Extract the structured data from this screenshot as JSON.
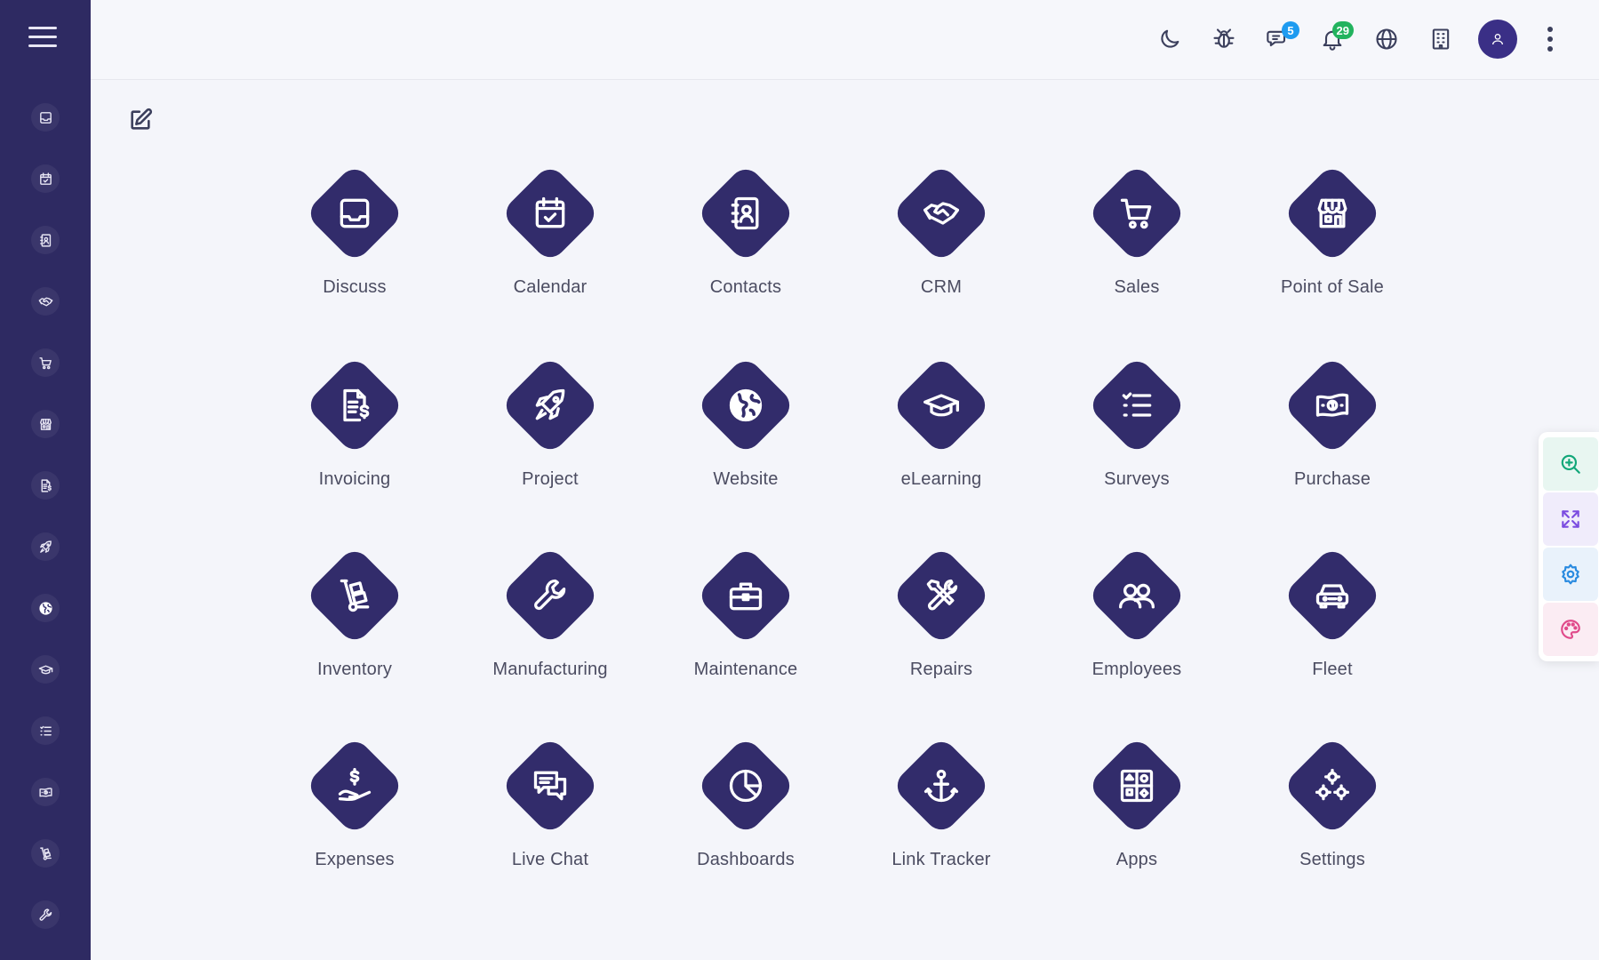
{
  "colors": {
    "sidebar_bg": "#2e2a62",
    "tile_bg": "#322c6b",
    "page_bg": "#f4f5fa",
    "badge_blue": "#1e9bf0",
    "badge_green": "#22b35e"
  },
  "sidebar": {
    "items": [
      {
        "icon": "inbox-icon"
      },
      {
        "icon": "calendar-check-icon"
      },
      {
        "icon": "contact-book-icon"
      },
      {
        "icon": "handshake-icon"
      },
      {
        "icon": "cart-icon"
      },
      {
        "icon": "store-icon"
      },
      {
        "icon": "invoice-icon"
      },
      {
        "icon": "rocket-icon"
      },
      {
        "icon": "globe-icon"
      },
      {
        "icon": "graduation-cap-icon"
      },
      {
        "icon": "checklist-icon"
      },
      {
        "icon": "banknote-icon"
      },
      {
        "icon": "hand-truck-icon"
      },
      {
        "icon": "wrench-icon"
      }
    ]
  },
  "topbar": {
    "chat_badge": "5",
    "notification_badge": "29"
  },
  "apps": [
    {
      "label": "Discuss",
      "icon": "inbox-icon"
    },
    {
      "label": "Calendar",
      "icon": "calendar-check-icon"
    },
    {
      "label": "Contacts",
      "icon": "contact-book-icon"
    },
    {
      "label": "CRM",
      "icon": "handshake-icon"
    },
    {
      "label": "Sales",
      "icon": "cart-icon"
    },
    {
      "label": "Point of Sale",
      "icon": "store-icon"
    },
    {
      "label": "Invoicing",
      "icon": "invoice-icon"
    },
    {
      "label": "Project",
      "icon": "rocket-icon"
    },
    {
      "label": "Website",
      "icon": "globe-icon"
    },
    {
      "label": "eLearning",
      "icon": "graduation-cap-icon"
    },
    {
      "label": "Surveys",
      "icon": "checklist-icon"
    },
    {
      "label": "Purchase",
      "icon": "banknote-icon"
    },
    {
      "label": "Inventory",
      "icon": "hand-truck-icon"
    },
    {
      "label": "Manufacturing",
      "icon": "wrench-icon"
    },
    {
      "label": "Maintenance",
      "icon": "toolbox-icon"
    },
    {
      "label": "Repairs",
      "icon": "tools-icon"
    },
    {
      "label": "Employees",
      "icon": "people-icon"
    },
    {
      "label": "Fleet",
      "icon": "car-icon"
    },
    {
      "label": "Expenses",
      "icon": "money-hand-icon"
    },
    {
      "label": "Live Chat",
      "icon": "chat-bubbles-icon"
    },
    {
      "label": "Dashboards",
      "icon": "pie-chart-icon"
    },
    {
      "label": "Link Tracker",
      "icon": "anchor-icon"
    },
    {
      "label": "Apps",
      "icon": "app-grid-icon"
    },
    {
      "label": "Settings",
      "icon": "gears-icon"
    }
  ],
  "right_tools": [
    {
      "icon": "zoom-in-icon",
      "color": "#12a779",
      "bg": "#e8f6f1"
    },
    {
      "icon": "expand-icon",
      "color": "#7b4ce0",
      "bg": "#f0ecfb"
    },
    {
      "icon": "gear-icon",
      "color": "#2a8be0",
      "bg": "#e9f2fb"
    },
    {
      "icon": "palette-icon",
      "color": "#e04b8b",
      "bg": "#fbecf3"
    }
  ]
}
